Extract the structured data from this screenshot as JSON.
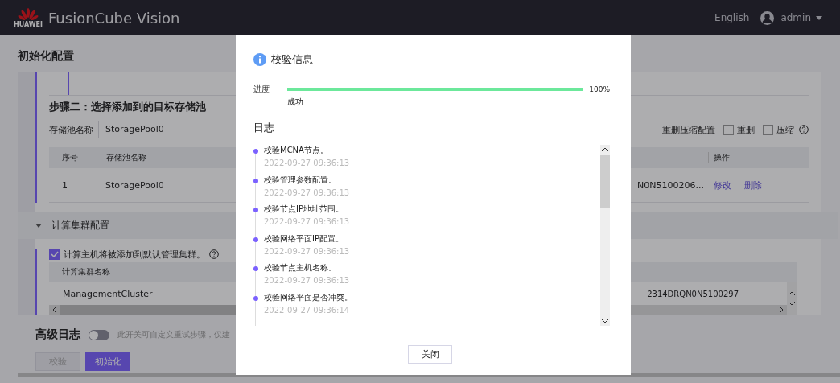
{
  "header": {
    "brand": "HUAWEI",
    "title": "FusionCube Vision",
    "language": "English",
    "user": "admin"
  },
  "page_title": "初始化配置",
  "storage": {
    "step_title": "步骤二：选择添加到的目标存储池",
    "pool_label": "存储池名称",
    "pool_value": "StoragePool0",
    "dedup_label": "重删压缩配置",
    "options": [
      {
        "label": "重删",
        "checked": false
      },
      {
        "label": "压缩",
        "checked": false
      }
    ],
    "columns": [
      "序号",
      "存储池名称",
      "操作"
    ],
    "rows": [
      {
        "index": "1",
        "name": "StoragePool0",
        "id": "N0N5100206...",
        "actions": [
          "修改",
          "删除"
        ]
      }
    ]
  },
  "compute": {
    "section_title": "计算集群配置",
    "expanded": true,
    "default_cluster": {
      "label": "计算主机将被添加到默认管理集群。",
      "checked": true
    },
    "column": "计算集群名称",
    "rows": [
      {
        "name": "ManagementCluster",
        "id": "2314DRQN0N5100297"
      }
    ]
  },
  "advanced_log": {
    "label": "高级日志",
    "on": false,
    "description": "此开关可自定义重试步骤，仅建"
  },
  "buttons": [
    {
      "label": "校验",
      "disabled": true
    },
    {
      "label": "初始化",
      "disabled": false
    }
  ],
  "dialog": {
    "title": "校验信息",
    "progress_label": "进度",
    "level": 1,
    "reading": "100%",
    "status": "成功",
    "log_title": "日志",
    "log": [
      {
        "message": "校验MCNA节点。",
        "time": "2022-09-27 09:36:13"
      },
      {
        "message": "校验管理参数配置。",
        "time": "2022-09-27 09:36:13"
      },
      {
        "message": "校验节点IP地址范围。",
        "time": "2022-09-27 09:36:13"
      },
      {
        "message": "校验网络平面IP配置。",
        "time": "2022-09-27 09:36:13"
      },
      {
        "message": "校验节点主机名称。",
        "time": "2022-09-27 09:36:13"
      },
      {
        "message": "校验网络平面是否冲突。",
        "time": "2022-09-27 09:36:14"
      }
    ],
    "close": "关闭"
  }
}
